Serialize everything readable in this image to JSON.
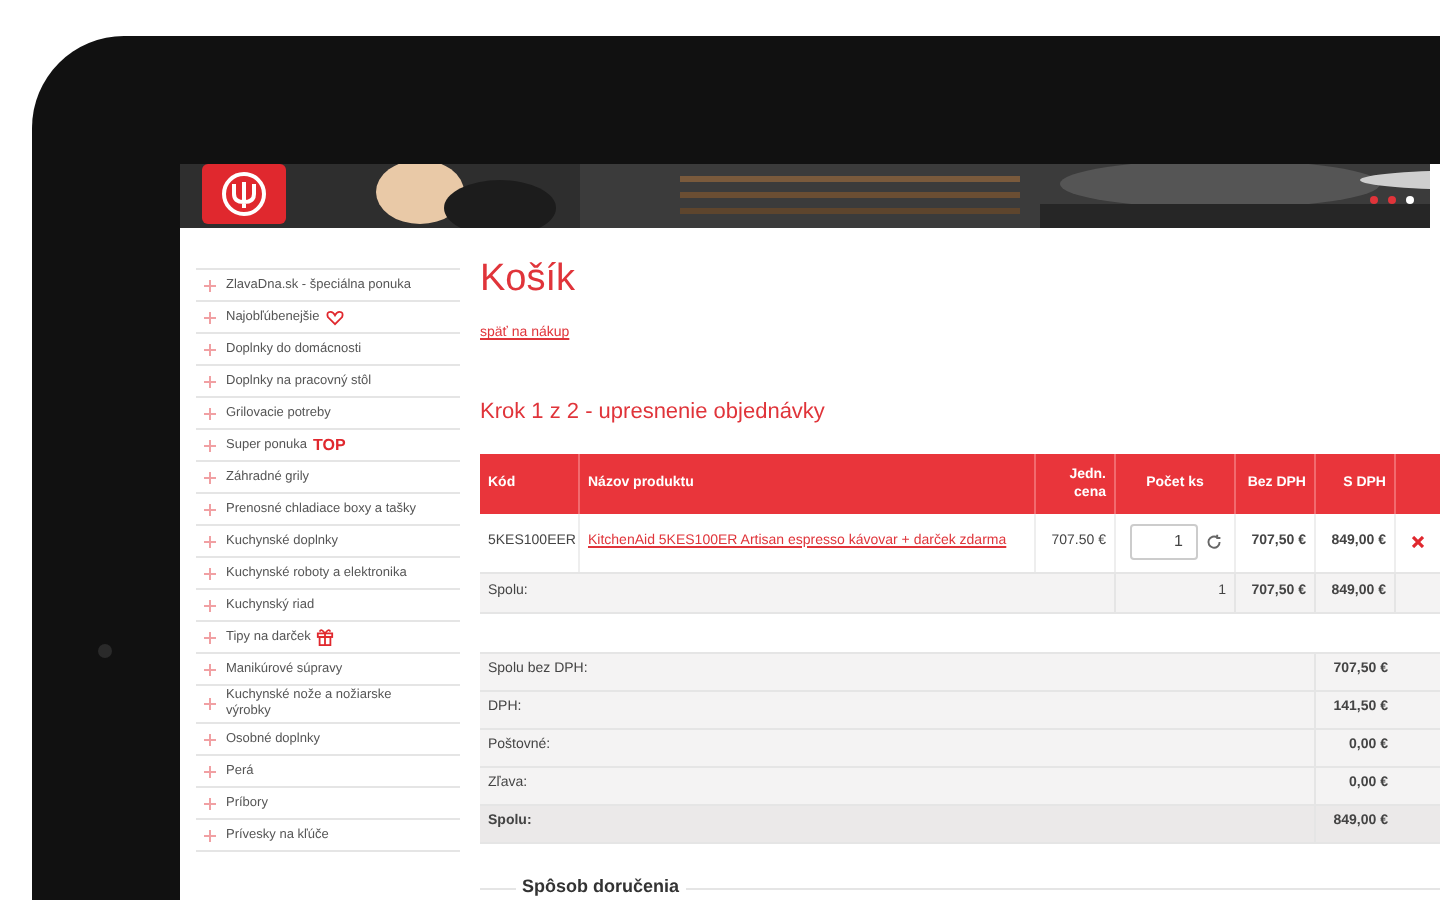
{
  "banner": {
    "slides": [
      {
        "selected": false
      },
      {
        "selected": false
      },
      {
        "selected": true
      }
    ]
  },
  "sidebar": {
    "items": [
      {
        "label": "ZlavaDna.sk - špeciálna ponuka"
      },
      {
        "label": "Najobľúbenejšie",
        "badge": {
          "kind": "heart"
        }
      },
      {
        "label": "Doplnky do domácnosti"
      },
      {
        "label": "Doplnky na pracovný stôl"
      },
      {
        "label": "Grilovacie potreby"
      },
      {
        "label": "Super ponuka",
        "badge": {
          "kind": "text",
          "text": "TOP"
        }
      },
      {
        "label": "Záhradné grily"
      },
      {
        "label": "Prenosné chladiace boxy a tašky"
      },
      {
        "label": "Kuchynské doplnky"
      },
      {
        "label": "Kuchynské roboty a elektronika"
      },
      {
        "label": "Kuchynský riad"
      },
      {
        "label": "Tipy na darček",
        "badge": {
          "kind": "gift"
        }
      },
      {
        "label": "Manikúrové súpravy"
      },
      {
        "label": "Kuchynské nože a nožiarske výrobky"
      },
      {
        "label": "Osobné doplnky"
      },
      {
        "label": "Perá"
      },
      {
        "label": "Príbory"
      },
      {
        "label": "Prívesky na kľúče"
      }
    ]
  },
  "cart": {
    "title": "Košík",
    "back_link": "späť na nákup",
    "step_title": "Krok 1 z 2 - upresnenie objednávky",
    "columns": [
      "Kód",
      "Názov produktu",
      "Jedn. cena",
      "Počet ks",
      "Bez DPH",
      "S DPH"
    ],
    "items": [
      {
        "code": "5KES100EER",
        "name": "KitchenAid 5KES100ER Artisan espresso kávovar + darček zdarma",
        "unit_price": "707.50 €",
        "quantity": "1",
        "price_without_vat": "707,50 €",
        "price_with_vat": "849,00 €"
      }
    ],
    "total_row": {
      "label": "Spolu:",
      "quantity": "1",
      "price_without_vat": "707,50 €",
      "price_with_vat": "849,00 €"
    },
    "summary": [
      {
        "label": "Spolu bez DPH:",
        "value": "707,50 €",
        "bold": false
      },
      {
        "label": "DPH:",
        "value": "141,50 €",
        "bold": false
      },
      {
        "label": "Poštovné:",
        "value": "0,00 €",
        "bold": false
      },
      {
        "label": "Zľava:",
        "value": "0,00 €",
        "bold": false
      },
      {
        "label": "Spolu:",
        "value": "849,00 €",
        "bold": true
      }
    ],
    "delivery_title": "Spôsob doručenia"
  }
}
